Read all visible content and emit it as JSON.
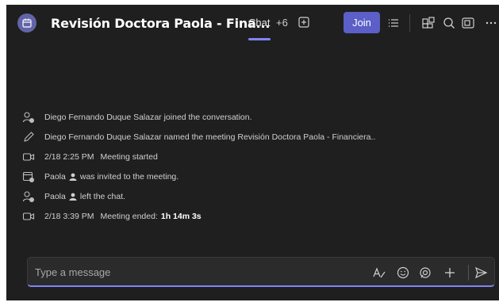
{
  "header": {
    "title": "Revisión Doctora Paola - Fina...",
    "tab_chat": "Chat",
    "tab_more": "+6",
    "join_label": "Join"
  },
  "messages": [
    {
      "icon": "person-join-icon",
      "text": "Diego Fernando Duque Salazar joined the conversation."
    },
    {
      "icon": "pencil-icon",
      "text": "Diego Fernando Duque Salazar named the meeting Revisión Doctora Paola - Financiera.."
    },
    {
      "icon": "video-camera-icon",
      "time": "2/18 2:25 PM",
      "text": "Meeting started"
    },
    {
      "icon": "calendar-invite-icon",
      "name": "Paola",
      "text": "was invited to the meeting."
    },
    {
      "icon": "person-left-icon",
      "name": "Paola",
      "text": "left the chat."
    },
    {
      "icon": "video-camera-icon",
      "time": "2/18 3:39 PM",
      "text": "Meeting ended:",
      "duration": "1h 14m 3s"
    }
  ],
  "compose": {
    "placeholder": "Type a message"
  },
  "colors": {
    "accent": "#5b5fc7",
    "accent_line": "#7f85f5",
    "background": "#1f1f1f",
    "compose_bg": "#2b2b2b"
  }
}
